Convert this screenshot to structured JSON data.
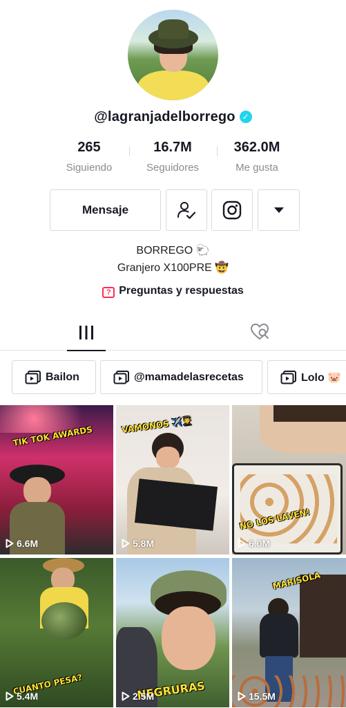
{
  "profile": {
    "username": "@lagranjadelborrego",
    "verified_mark": "✓",
    "stats": [
      {
        "value": "265",
        "label": "Siguiendo"
      },
      {
        "value": "16.7M",
        "label": "Seguidores"
      },
      {
        "value": "362.0M",
        "label": "Me gusta"
      }
    ]
  },
  "actions": {
    "message_label": "Mensaje",
    "follow_icon": "user-check-icon",
    "instagram_icon": "instagram-icon",
    "more_icon": "caret-down-icon"
  },
  "bio": {
    "line1": "BORREGO 🐑",
    "line2": "Granjero X100PRE 🤠"
  },
  "qa": {
    "icon_glyph": "?",
    "label": "Preguntas y respuestas"
  },
  "tabs": {
    "videos_icon": "grid-icon",
    "liked_icon": "liked-hidden-icon"
  },
  "playlists": [
    {
      "label": "Bailon"
    },
    {
      "label": "@mamadelasrecetas"
    },
    {
      "label": "Lolo 🐷"
    }
  ],
  "videos": [
    {
      "caption": "TIK TOK AWARDS",
      "views": "6.6M"
    },
    {
      "caption": "VAMONOS ✈️👨‍🎓",
      "views": "5.8M"
    },
    {
      "caption": "NO LOS LAVEN!",
      "views": "6.0M"
    },
    {
      "caption": "CUANTO PESA?",
      "views": "5.4M"
    },
    {
      "caption": "NEGRURAS",
      "views": "2.5M"
    },
    {
      "caption": "MARISOLA",
      "views": "15.5M"
    }
  ],
  "colors": {
    "accent": "#fe2c55",
    "verified": "#20d5ec",
    "text": "#161823",
    "muted": "#8a8b91"
  }
}
